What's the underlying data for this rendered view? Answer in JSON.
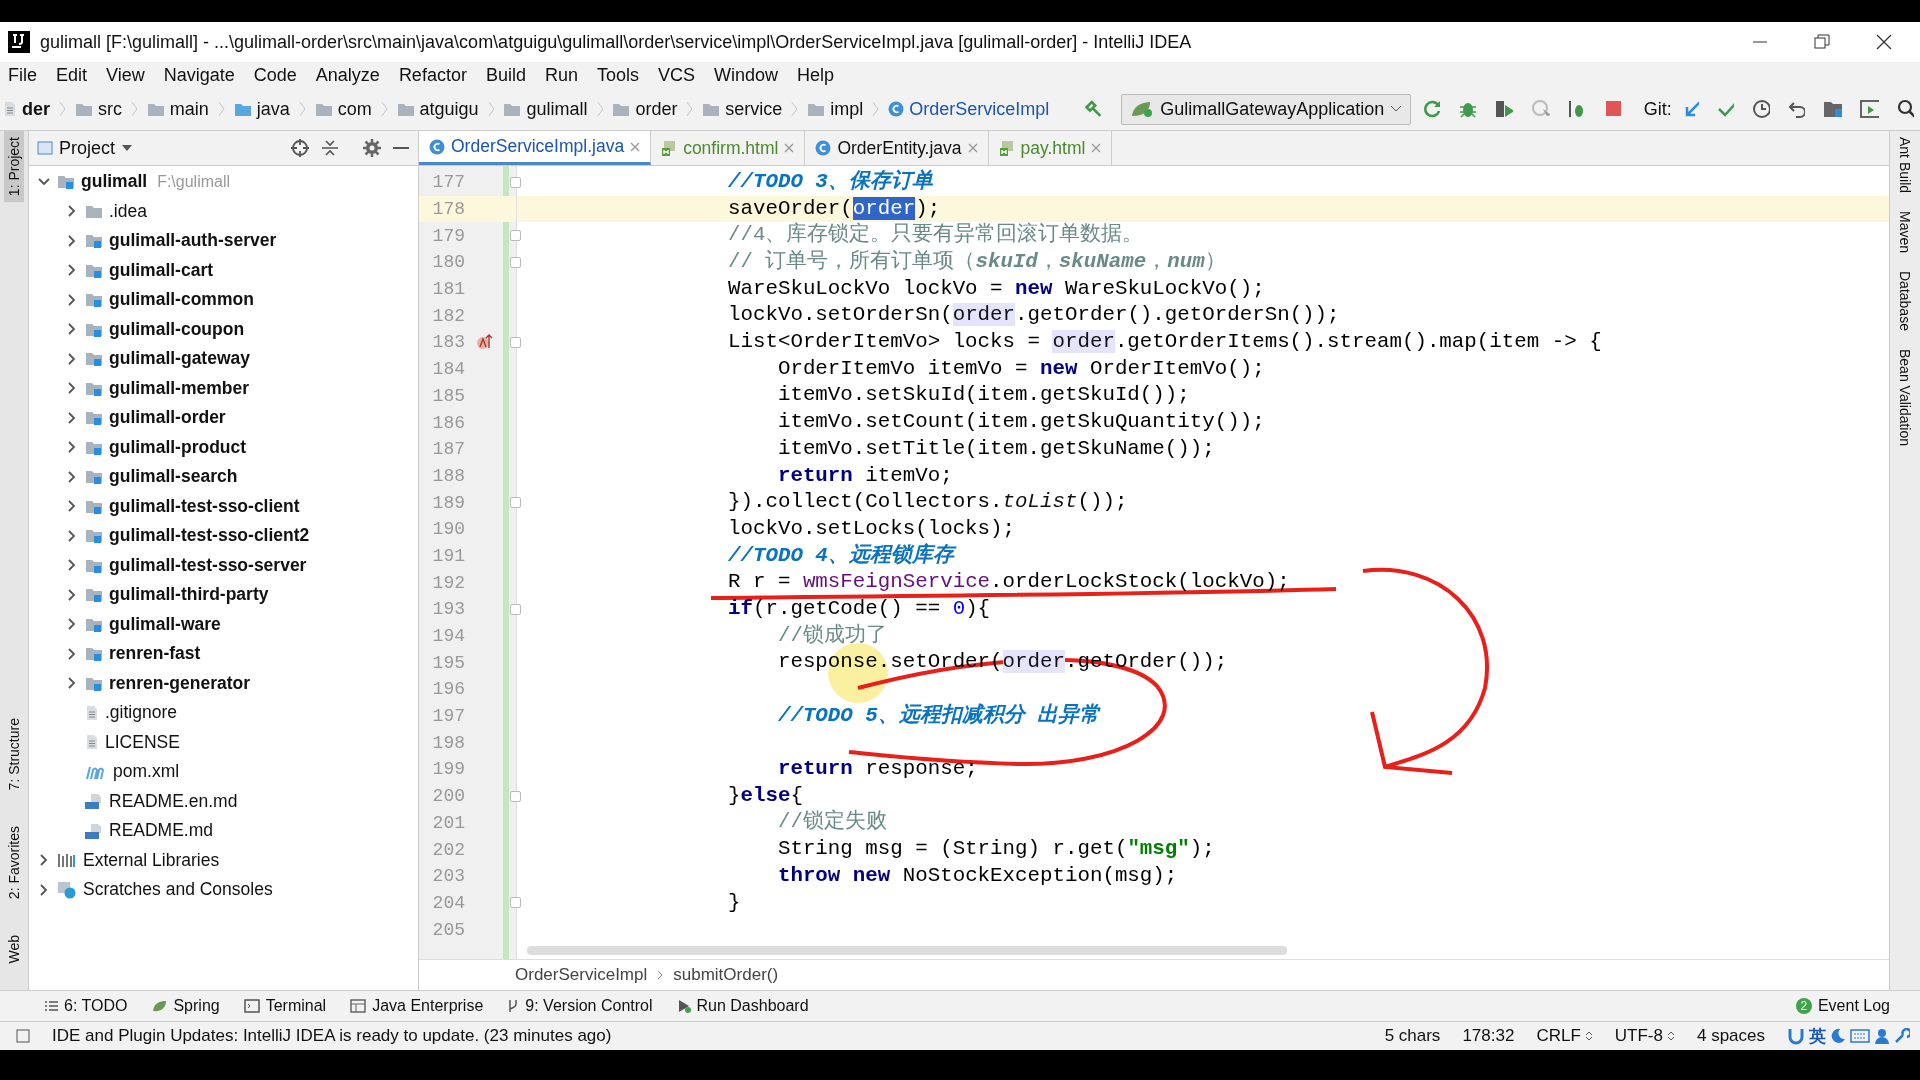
{
  "window": {
    "title": "gulimall [F:\\gulimall] - ...\\gulimall-order\\src\\main\\java\\com\\atguigu\\gulimall\\order\\service\\impl\\OrderServiceImpl.java [gulimall-order] - IntelliJ IDEA"
  },
  "menu": [
    "File",
    "Edit",
    "View",
    "Navigate",
    "Code",
    "Analyze",
    "Refactor",
    "Build",
    "Run",
    "Tools",
    "VCS",
    "Window",
    "Help"
  ],
  "nav_bar": {
    "crumbs": [
      {
        "label": "der",
        "kind": "text"
      },
      {
        "label": "src",
        "kind": "folder"
      },
      {
        "label": "main",
        "kind": "folder"
      },
      {
        "label": "java",
        "kind": "source"
      },
      {
        "label": "com",
        "kind": "package"
      },
      {
        "label": "atguigu",
        "kind": "package"
      },
      {
        "label": "gulimall",
        "kind": "package"
      },
      {
        "label": "order",
        "kind": "package"
      },
      {
        "label": "service",
        "kind": "package"
      },
      {
        "label": "impl",
        "kind": "package"
      },
      {
        "label": "OrderServiceImpl",
        "kind": "class"
      }
    ],
    "run_config": "GulimallGatewayApplication",
    "git_label": "Git:"
  },
  "left_stripe": [
    {
      "label": "1: Project",
      "selected": true
    },
    {
      "label": "7: Structure",
      "selected": false
    },
    {
      "label": "2: Favorites",
      "selected": false
    },
    {
      "label": "Web",
      "selected": false
    }
  ],
  "right_stripe": [
    "Ant Build",
    "Maven",
    "Database",
    "Bean Validation"
  ],
  "project": {
    "title": "Project",
    "root": {
      "label": "gulimall",
      "path": "F:\\gulimall",
      "expanded": true,
      "children": [
        {
          "label": ".idea",
          "kind": "folder",
          "expanded": false
        },
        {
          "label": "gulimall-auth-server",
          "kind": "module",
          "expanded": false
        },
        {
          "label": "gulimall-cart",
          "kind": "module",
          "expanded": false
        },
        {
          "label": "gulimall-common",
          "kind": "module",
          "expanded": false
        },
        {
          "label": "gulimall-coupon",
          "kind": "module",
          "expanded": false
        },
        {
          "label": "gulimall-gateway",
          "kind": "module",
          "expanded": false
        },
        {
          "label": "gulimall-member",
          "kind": "module",
          "expanded": false
        },
        {
          "label": "gulimall-order",
          "kind": "module",
          "expanded": false
        },
        {
          "label": "gulimall-product",
          "kind": "module",
          "expanded": false
        },
        {
          "label": "gulimall-search",
          "kind": "module",
          "expanded": false
        },
        {
          "label": "gulimall-test-sso-client",
          "kind": "module",
          "expanded": false
        },
        {
          "label": "gulimall-test-sso-client2",
          "kind": "module",
          "expanded": false
        },
        {
          "label": "gulimall-test-sso-server",
          "kind": "module",
          "expanded": false
        },
        {
          "label": "gulimall-third-party",
          "kind": "module",
          "expanded": false
        },
        {
          "label": "gulimall-ware",
          "kind": "module",
          "expanded": false
        },
        {
          "label": "renren-fast",
          "kind": "module",
          "expanded": false
        },
        {
          "label": "renren-generator",
          "kind": "module",
          "expanded": false
        },
        {
          "label": ".gitignore",
          "kind": "text"
        },
        {
          "label": "LICENSE",
          "kind": "text"
        },
        {
          "label": "pom.xml",
          "kind": "maven"
        },
        {
          "label": "README.en.md",
          "kind": "md"
        },
        {
          "label": "README.md",
          "kind": "md"
        }
      ]
    },
    "extra": [
      {
        "label": "External Libraries",
        "kind": "libraries",
        "expanded": false
      },
      {
        "label": "Scratches and Consoles",
        "kind": "scratches",
        "expanded": false
      }
    ]
  },
  "tabs": [
    {
      "label": "OrderServiceImpl.java",
      "kind": "java",
      "selected": true
    },
    {
      "label": "confirm.html",
      "kind": "html",
      "selected": false
    },
    {
      "label": "OrderEntity.java",
      "kind": "java",
      "selected": false
    },
    {
      "label": "pay.html",
      "kind": "html",
      "selected": false
    }
  ],
  "editor": {
    "lines": [
      {
        "number": "177",
        "fold": true,
        "tokens": [
          {
            "text": "//TODO 3、保存订单",
            "kind": "todo"
          }
        ]
      },
      {
        "number": "178",
        "current": true,
        "tokens": [
          {
            "text": "saveOrder(",
            "kind": "p"
          },
          {
            "text": "order",
            "kind": "sel"
          },
          {
            "text": ");",
            "kind": "p"
          }
        ]
      },
      {
        "number": "179",
        "fold": true,
        "tokens": [
          {
            "text": "//4、库存锁定。只要有异常回滚订单数据。",
            "kind": "c"
          }
        ]
      },
      {
        "number": "180",
        "fold": true,
        "tokens": [
          {
            "text": "// 订单号，所有订单项（",
            "kind": "c"
          },
          {
            "text": "skuId",
            "kind": "ci"
          },
          {
            "text": "，",
            "kind": "c"
          },
          {
            "text": "skuName",
            "kind": "ci"
          },
          {
            "text": "，",
            "kind": "c"
          },
          {
            "text": "num",
            "kind": "ci"
          },
          {
            "text": "）",
            "kind": "c"
          }
        ]
      },
      {
        "number": "181",
        "tokens": [
          {
            "text": "WareSkuLockVo lockVo = ",
            "kind": "p"
          },
          {
            "text": "new",
            "kind": "k"
          },
          {
            "text": " WareSkuLockVo();",
            "kind": "p"
          }
        ]
      },
      {
        "number": "182",
        "tokens": [
          {
            "text": "lockVo.setOrderSn(",
            "kind": "p"
          },
          {
            "text": "order",
            "kind": "h"
          },
          {
            "text": ".getOrder().getOrderSn());",
            "kind": "p"
          }
        ]
      },
      {
        "number": "183",
        "fold": true,
        "gutter_icon": true,
        "tokens": [
          {
            "text": "List<OrderItemVo> locks = ",
            "kind": "p"
          },
          {
            "text": "order",
            "kind": "h"
          },
          {
            "text": ".getOrderItems().stream().map(item -> {",
            "kind": "p"
          }
        ]
      },
      {
        "number": "184",
        "tokens": [
          {
            "text": "    OrderItemVo itemVo = ",
            "kind": "p"
          },
          {
            "text": "new",
            "kind": "k"
          },
          {
            "text": " OrderItemVo();",
            "kind": "p"
          }
        ]
      },
      {
        "number": "185",
        "tokens": [
          {
            "text": "    itemVo.setSkuId(item.getSkuId());",
            "kind": "p"
          }
        ]
      },
      {
        "number": "186",
        "tokens": [
          {
            "text": "    itemVo.setCount(item.getSkuQuantity());",
            "kind": "p"
          }
        ]
      },
      {
        "number": "187",
        "tokens": [
          {
            "text": "    itemVo.setTitle(item.getSkuName());",
            "kind": "p"
          }
        ]
      },
      {
        "number": "188",
        "tokens": [
          {
            "text": "    return",
            "kind": "k"
          },
          {
            "text": " itemVo;",
            "kind": "p"
          }
        ]
      },
      {
        "number": "189",
        "fold": true,
        "tokens": [
          {
            "text": "}).collect(Collectors.",
            "kind": "p"
          },
          {
            "text": "toList",
            "kind": "i"
          },
          {
            "text": "());",
            "kind": "p"
          }
        ]
      },
      {
        "number": "190",
        "tokens": [
          {
            "text": "lockVo.setLocks(locks);",
            "kind": "p"
          }
        ]
      },
      {
        "number": "191",
        "tokens": [
          {
            "text": "//TODO 4、远程锁库存",
            "kind": "todo"
          }
        ]
      },
      {
        "number": "192",
        "tokens": [
          {
            "text": "R r = ",
            "kind": "p"
          },
          {
            "text": "wmsFeignService",
            "kind": "f"
          },
          {
            "text": ".orderLockStock(lockVo);",
            "kind": "p"
          }
        ]
      },
      {
        "number": "193",
        "fold": true,
        "tokens": [
          {
            "text": "if",
            "kind": "k"
          },
          {
            "text": "(r.getCode() == ",
            "kind": "p"
          },
          {
            "text": "0",
            "kind": "n"
          },
          {
            "text": "){",
            "kind": "p"
          }
        ]
      },
      {
        "number": "194",
        "tokens": [
          {
            "text": "    //锁成功了",
            "kind": "c"
          }
        ]
      },
      {
        "number": "195",
        "tokens": [
          {
            "text": "    response.setOrder(",
            "kind": "p"
          },
          {
            "text": "order",
            "kind": "h"
          },
          {
            "text": ".getOrder());",
            "kind": "p"
          }
        ]
      },
      {
        "number": "196"
      },
      {
        "number": "197",
        "tokens": [
          {
            "text": "    //TODO 5、远程扣减积分 出异常",
            "kind": "todo"
          }
        ]
      },
      {
        "number": "198"
      },
      {
        "number": "199",
        "tokens": [
          {
            "text": "    return",
            "kind": "k"
          },
          {
            "text": " response;",
            "kind": "p"
          }
        ]
      },
      {
        "number": "200",
        "fold": true,
        "tokens": [
          {
            "text": "}",
            "kind": "p"
          },
          {
            "text": "else",
            "kind": "k"
          },
          {
            "text": "{",
            "kind": "p"
          }
        ]
      },
      {
        "number": "201",
        "tokens": [
          {
            "text": "    //锁定失败",
            "kind": "c"
          }
        ]
      },
      {
        "number": "202",
        "tokens": [
          {
            "text": "    String msg = (String) r.get(",
            "kind": "p"
          },
          {
            "text": "\"msg\"",
            "kind": "s"
          },
          {
            "text": ");",
            "kind": "p"
          }
        ]
      },
      {
        "number": "203",
        "tokens": [
          {
            "text": "    throw",
            "kind": "k"
          },
          {
            "text": " new",
            "kind": "k"
          },
          {
            "text": " NoStockException(msg);",
            "kind": "p"
          }
        ]
      },
      {
        "number": "204",
        "fold": true,
        "tokens": [
          {
            "text": "}",
            "kind": "p"
          }
        ]
      },
      {
        "number": "205"
      }
    ],
    "breadcrumb": [
      "OrderServiceImpl",
      "submitOrder()"
    ]
  },
  "tool_windows": [
    {
      "label": "6: TODO",
      "kind": "todo"
    },
    {
      "label": "Spring",
      "kind": "spring"
    },
    {
      "label": "Terminal",
      "kind": "terminal"
    },
    {
      "label": "Java Enterprise",
      "kind": "enterprise"
    },
    {
      "label": "9: Version Control",
      "kind": "vcs"
    },
    {
      "label": "Run Dashboard",
      "kind": "run"
    }
  ],
  "event_log": {
    "label": "Event Log",
    "count": "2"
  },
  "status_bar": {
    "message": "IDE and Plugin Updates: IntelliJ IDEA is ready to update. (23 minutes ago)",
    "chars": "5 chars",
    "position": "178:32",
    "line_sep": "CRLF",
    "encoding": "UTF-8",
    "indent": "4 spaces",
    "ime": "英"
  }
}
